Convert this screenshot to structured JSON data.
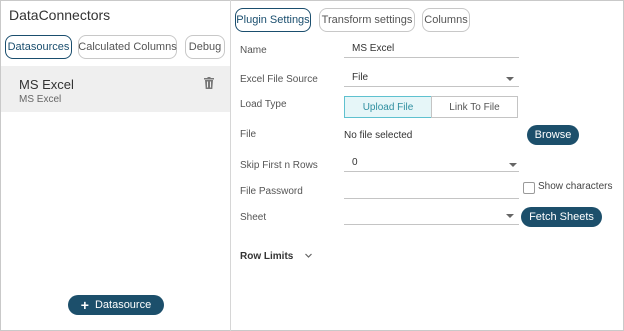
{
  "app": {
    "title": "DataConnectors"
  },
  "left_tabs": [
    {
      "label": "Datasources",
      "active": true
    },
    {
      "label": "Calculated Columns",
      "active": false
    },
    {
      "label": "Debug",
      "active": false
    }
  ],
  "datasource": {
    "name": "MS Excel",
    "type": "MS Excel",
    "delete_icon": "trash-icon"
  },
  "add_button": {
    "label": "Datasource",
    "icon": "plus-icon"
  },
  "right_tabs": [
    {
      "label": "Plugin Settings",
      "active": true
    },
    {
      "label": "Transform settings",
      "active": false
    },
    {
      "label": "Columns",
      "active": false
    }
  ],
  "form": {
    "name_label": "Name",
    "name_value": "MS Excel",
    "source_label": "Excel File Source",
    "source_value": "File",
    "load_label": "Load Type",
    "load_options": [
      "Upload File",
      "Link To File"
    ],
    "load_selected": "Upload File",
    "file_label": "File",
    "file_value": "No file selected",
    "browse_label": "Browse",
    "skip_label": "Skip First n Rows",
    "skip_value": "0",
    "password_label": "File Password",
    "password_value": "",
    "show_chars_label": "Show characters",
    "sheet_label": "Sheet",
    "sheet_value": "",
    "fetch_label": "Fetch Sheets",
    "row_limits_label": "Row Limits"
  },
  "colors": {
    "accent": "#1c4f6b",
    "segment_on_bg": "#e6f6f8",
    "segment_on_text": "#2f8fa0"
  }
}
